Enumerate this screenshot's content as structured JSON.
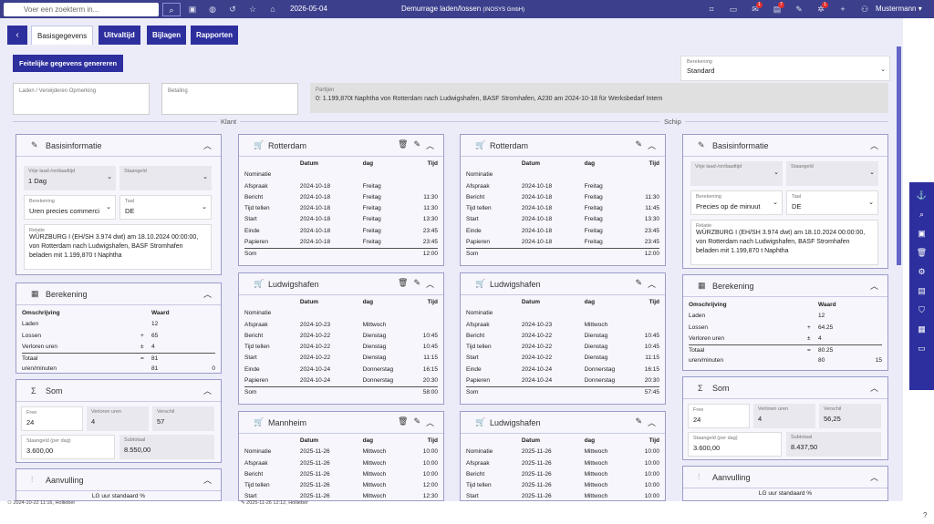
{
  "topbar": {
    "search_placeholder": "Voer een zoekterm in...",
    "date": "2026-05-04",
    "title": "Demurrage laden/lossen",
    "company": "(INOSYS GmbH)",
    "user": "Mustermann",
    "badges": [
      "1",
      "7",
      "1"
    ]
  },
  "tabs": [
    "Basisgegevens",
    "Uitvaltijd",
    "Bijlagen",
    "Rapporten"
  ],
  "generate_button": "Feitelijke gegevens genereren",
  "berekening_select": {
    "label": "Berekening",
    "value": "Standard"
  },
  "opmerking_label": "Laden / Verwijderen Opmerking",
  "betaling_label": "Betaling",
  "partijen": {
    "label": "Partijen",
    "value": "0: 1.199,870t Naphtha von Rotterdam nach Ludwigshafen, BASF Stromhafen, A230 am 2024-10-18 für Werksbedarf Intern"
  },
  "sections": {
    "klant": "Klant",
    "schip": "Schip"
  },
  "left": {
    "basis": {
      "title": "Basisinformatie",
      "vrije_label": "Vrije laad-/ontlaadtijd",
      "vrije_value": "1 Dag",
      "staangeld_label": "Staangeld",
      "ber_label": "Berekening",
      "ber_value": "Uren precies commerci",
      "taal_label": "Taal",
      "taal_value": "DE",
      "relatie_label": "Relatie",
      "relatie_value": "WÜRZBURG I (EH/SH 3.974 dwt) am 18.10.2024 00:00:00, von Rotterdam nach Ludwigshafen, BASF Stromhafen beladen mit 1.199,870 t Naphtha"
    },
    "berekening": {
      "title": "Berekening",
      "h1": "Omschrijving",
      "h2": "Waard",
      "rows": [
        [
          "Laden",
          "",
          "12",
          ""
        ],
        [
          "Lossen",
          "+",
          "65",
          ""
        ],
        [
          "Verloren uren",
          "±",
          "4",
          ""
        ],
        [
          "Totaal",
          "=",
          "81",
          ""
        ],
        [
          "uren/minuten",
          "",
          "81",
          "0"
        ]
      ]
    },
    "som": {
      "title": "Som",
      "free_l": "Free",
      "free_v": "24",
      "vu_l": "Verloren uren",
      "vu_v": "4",
      "ver_l": "Verschil",
      "ver_v": "57",
      "st_l": "Staangeld (per dag)",
      "st_v": "3.600,00",
      "sub_l": "Subtotaal",
      "sub_v": "8.550,00"
    },
    "aanvulling": {
      "title": "Aanvulling",
      "sub": "LG uur standaard %"
    }
  },
  "right": {
    "basis": {
      "title": "Basisinformatie",
      "vrije_label": "Vrije laad-/ontlaadtijd",
      "staangeld_label": "Staangeld",
      "ber_label": "Berekening",
      "ber_value": "Precies op de minuut",
      "taal_label": "Taal",
      "taal_value": "DE",
      "relatie_label": "Relatie",
      "relatie_value": "WÜRZBURG I (EH/SH 3.974 dwt) am 18.10.2024 00:00:00, von Rotterdam nach Ludwigshafen, BASF Stromhafen beladen mit 1.199,870 t Naphtha"
    },
    "berekening": {
      "title": "Berekening",
      "h1": "Omschrijving",
      "h2": "Waard",
      "rows": [
        [
          "Laden",
          "",
          "12",
          ""
        ],
        [
          "Lossen",
          "+",
          "64.25",
          ""
        ],
        [
          "Verloren uren",
          "±",
          "4",
          ""
        ],
        [
          "Totaal",
          "=",
          "80.25",
          ""
        ],
        [
          "uren/minuten",
          "",
          "80",
          "15"
        ]
      ]
    },
    "som": {
      "title": "Som",
      "free_l": "Free",
      "free_v": "24",
      "vu_l": "Verloren uren",
      "vu_v": "4",
      "ver_l": "Verschil",
      "ver_v": "56,25",
      "st_l": "Staangeld (per dag)",
      "st_v": "3.600,00",
      "sub_l": "Subtotaal",
      "sub_v": "8.437,50"
    },
    "aanvulling": {
      "title": "Aanvulling",
      "sub": "LG uur standaard %"
    }
  },
  "ports": [
    {
      "title": "Rotterdam",
      "hdr": [
        "",
        "Datum",
        "dag",
        "Tijd"
      ],
      "rows": [
        [
          "Nominatie",
          "",
          "",
          ""
        ],
        [
          "Afspraak",
          "2024-10-18",
          "Freitag",
          ""
        ],
        [
          "Bericht",
          "2024-10-18",
          "Freitag",
          "11:30"
        ],
        [
          "Tijd tellen",
          "2024-10-18",
          "Freitag",
          "11:30"
        ],
        [
          "Start",
          "2024-10-18",
          "Freitag",
          "13:30"
        ],
        [
          "Einde",
          "2024-10-18",
          "Freitag",
          "23:45"
        ],
        [
          "Papieren",
          "2024-10-18",
          "Freitag",
          "23:45"
        ],
        [
          "Som",
          "",
          "",
          "12:00"
        ]
      ]
    },
    {
      "title": "Rotterdam",
      "hdr": [
        "",
        "Datum",
        "dag",
        "Tijd"
      ],
      "rows": [
        [
          "Nominatie",
          "",
          "",
          ""
        ],
        [
          "Afspraak",
          "2024-10-18",
          "Freitag",
          ""
        ],
        [
          "Bericht",
          "2024-10-18",
          "Freitag",
          "11:30"
        ],
        [
          "Tijd tellen",
          "2024-10-18",
          "Freitag",
          "11:45"
        ],
        [
          "Start",
          "2024-10-18",
          "Freitag",
          "13:30"
        ],
        [
          "Einde",
          "2024-10-18",
          "Freitag",
          "23:45"
        ],
        [
          "Papieren",
          "2024-10-18",
          "Freitag",
          "23:45"
        ],
        [
          "Som",
          "",
          "",
          "12:00"
        ]
      ]
    },
    {
      "title": "Ludwigshafen",
      "hdr": [
        "",
        "Datum",
        "dag",
        "Tijd"
      ],
      "rows": [
        [
          "Nominatie",
          "",
          "",
          ""
        ],
        [
          "Afspraak",
          "2024-10-23",
          "Mittwoch",
          ""
        ],
        [
          "Bericht",
          "2024-10-22",
          "Dienstag",
          "10:45"
        ],
        [
          "Tijd tellen",
          "2024-10-22",
          "Dienstag",
          "10:45"
        ],
        [
          "Start",
          "2024-10-22",
          "Dienstag",
          "11:15"
        ],
        [
          "Einde",
          "2024-10-24",
          "Donnerstag",
          "16:15"
        ],
        [
          "Papieren",
          "2024-10-24",
          "Donnerstag",
          "20:30"
        ],
        [
          "Som",
          "",
          "",
          "58:00"
        ]
      ]
    },
    {
      "title": "Ludwigshafen",
      "hdr": [
        "",
        "Datum",
        "dag",
        "Tijd"
      ],
      "rows": [
        [
          "Nominatie",
          "",
          "",
          ""
        ],
        [
          "Afspraak",
          "2024-10-23",
          "Mittwoch",
          ""
        ],
        [
          "Bericht",
          "2024-10-22",
          "Dienstag",
          "10:45"
        ],
        [
          "Tijd tellen",
          "2024-10-22",
          "Dienstag",
          "10:45"
        ],
        [
          "Start",
          "2024-10-22",
          "Dienstag",
          "11:15"
        ],
        [
          "Einde",
          "2024-10-24",
          "Donnerstag",
          "16:15"
        ],
        [
          "Papieren",
          "2024-10-24",
          "Donnerstag",
          "20:30"
        ],
        [
          "Som",
          "",
          "",
          "57:45"
        ]
      ]
    },
    {
      "title": "Mannheim",
      "hdr": [
        "",
        "Datum",
        "dag",
        "Tijd"
      ],
      "rows": [
        [
          "Nominatie",
          "2025-11-26",
          "Mittwoch",
          "10:00"
        ],
        [
          "Afspraak",
          "2025-11-26",
          "Mittwoch",
          "10:00"
        ],
        [
          "Bericht",
          "2025-11-26",
          "Mittwoch",
          "10:00"
        ],
        [
          "Tijd tellen",
          "2025-11-26",
          "Mittwoch",
          "12:00"
        ],
        [
          "Start",
          "2025-11-26",
          "Mittwoch",
          "12:30"
        ]
      ]
    },
    {
      "title": "Ludwigshafen",
      "hdr": [
        "",
        "Datum",
        "dag",
        "Tijd"
      ],
      "rows": [
        [
          "Nominatie",
          "2025-11-26",
          "Mittwoch",
          "10:00"
        ],
        [
          "Afspraak",
          "2025-11-26",
          "Mittwoch",
          "10:00"
        ],
        [
          "Bericht",
          "2025-11-26",
          "Mittwoch",
          "10:00"
        ],
        [
          "Tijd tellen",
          "2025-11-26",
          "Mittwoch",
          "10:00"
        ],
        [
          "Start",
          "2025-11-26",
          "Mittwoch",
          "10:00"
        ]
      ]
    }
  ],
  "footer": {
    "left": "2024-10-22 11:16, Hollieber",
    "mid": "2025-11-26 12:12, Hollieber"
  }
}
